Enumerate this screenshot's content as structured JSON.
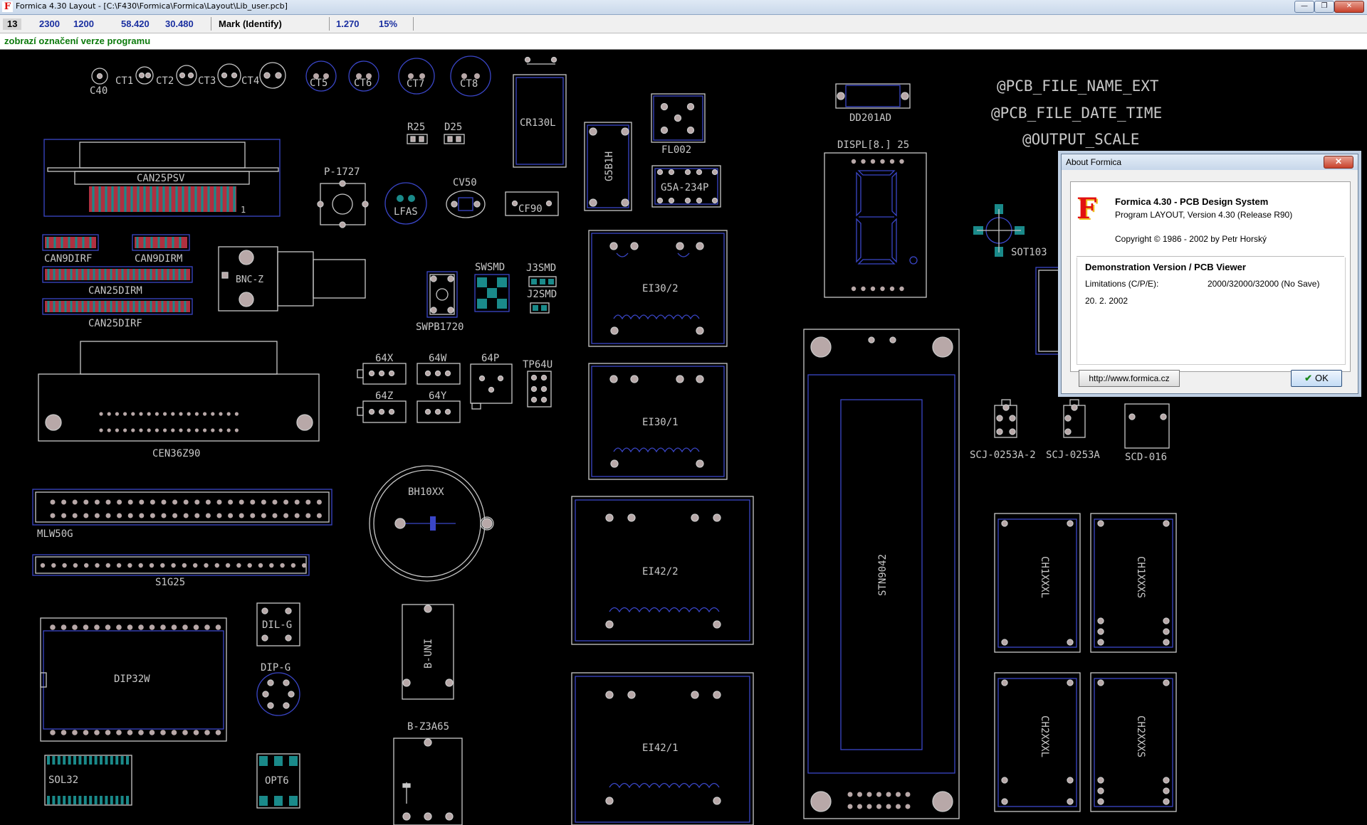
{
  "window": {
    "title": "Formica 4.30 Layout - [C:\\F430\\Formica\\Formica\\Layout\\Lib_user.pcb]",
    "icon": "formica-logo-icon",
    "buttons": {
      "minimize": "—",
      "restore": "❐",
      "close": "✕"
    }
  },
  "statusbar": {
    "layer": "13",
    "coord_x": "2300",
    "coord_y": "1200",
    "pos_x": "58.420",
    "pos_y": "30.480",
    "mode": "Mark (Identify)",
    "grid": "1.270",
    "zoom": "15%"
  },
  "hint": "zobrazí označení verze programu",
  "pcb": {
    "colors": {
      "background": "#000000",
      "outline": "#c8c8c8",
      "pads": "#b8a8a8",
      "copper": "#1a8a8a",
      "blue": "#3a46c8",
      "red": "#c83a4a"
    },
    "components": [
      "C40",
      "CT1",
      "CT2",
      "CT3",
      "CT4",
      "CT5",
      "CT6",
      "CT7",
      "CT8",
      "R25",
      "D25",
      "CR130L",
      "G5B1H",
      "FL002",
      "G5A-234P",
      "CAN25PSV",
      "P-1727",
      "LFAS",
      "CV50",
      "CF90",
      "CAN9DIRF",
      "CAN9DIRM",
      "CAN25DIRM",
      "CAN25DIRF",
      "BNC-Z",
      "SWPB1720",
      "SWSMD",
      "J3SMD",
      "J2SMD",
      "64X",
      "64W",
      "64P",
      "TP64U",
      "64Z",
      "64Y",
      "CEN36Z90",
      "EI30/2",
      "EI30/1",
      "EI42/2",
      "EI42/1",
      "MLW50G",
      "S1G25",
      "BH10XX",
      "DIL-G",
      "DIP-G",
      "DIP32W",
      "B-UNI",
      "B-Z3A65",
      "SOL32",
      "OPT6",
      "DD201AD",
      "DISPL[8.] 25",
      "SOT103",
      "STN9042",
      "SCJ-0253A-2",
      "SCJ-0253A",
      "SCD-016",
      "CH1XXXL",
      "CH1XXXS",
      "CH2XXXL",
      "CH2XXXS"
    ],
    "pin_one": "1",
    "placeholders": [
      "@PCB_FILE_NAME_EXT",
      "@PCB_FILE_DATE_TIME",
      "@OUTPUT_SCALE"
    ]
  },
  "about": {
    "caption": "About Formica",
    "close": "✕",
    "logo": "F",
    "product": "Formica 4.30 - PCB Design System",
    "program": "Program LAYOUT, Version 4.30  (Release R90)",
    "copyright": "Copyright © 1986 - 2002 by Petr Horský",
    "edition": "Demonstration Version / PCB Viewer",
    "limits_label": "Limitations (C/P/E):",
    "limits_value": "2000/32000/32000 (No Save)",
    "date": "20. 2. 2002",
    "url_button": "http://www.formica.cz",
    "ok_button": "OK"
  }
}
